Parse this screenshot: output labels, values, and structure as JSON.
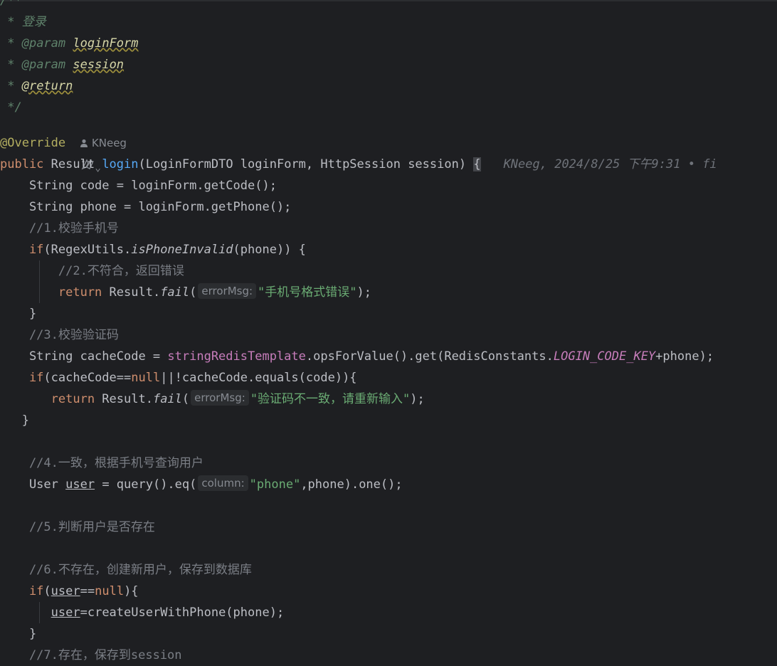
{
  "colors": {
    "background": "#1e1f22",
    "keyword": "#cf8e6d",
    "string": "#6aab73",
    "function": "#56a8f5",
    "comment": "#7a7e85",
    "doc": "#5f826b",
    "field": "#c77dbb",
    "annotation": "#b3ae60"
  },
  "doc": {
    "open": "/**",
    "title": " * 登录",
    "param_prefix": " * ",
    "param_tag": "@param",
    "param1": "loginForm",
    "param2": "session",
    "return_tag": "@return",
    "close": " */"
  },
  "gutter": {
    "ai_icon": "ai-assistant-icon",
    "chevron": "⌄",
    "person_icon": "person-icon",
    "author": "KNeeg"
  },
  "code": {
    "override": "@Override",
    "sig_public": "public",
    "sig_type": " Result ",
    "sig_name": "login",
    "sig_params": "(LoginFormDTO loginForm, HttpSession session) ",
    "sig_brace": "{",
    "blame": "KNeeg, 2024/8/25 下午9:31 • fi",
    "l1": "    String code = loginForm.getCode();",
    "l2": "    String phone = loginForm.getPhone();",
    "c1": "    //1.校验手机号",
    "if1_kw": "    if",
    "if1_a": "(RegexUtils.",
    "if1_fn": "isPhoneInvalid",
    "if1_b": "(phone)) {",
    "c2": "        //2.不符合，返回错误",
    "ret1_kw": "        return",
    "ret1_a": " Result.",
    "ret1_fn": "fail",
    "ret1_paren": "(",
    "hint_errorMsg": "errorMsg:",
    "ret1_str": "\"手机号格式错误\"",
    "ret1_end": ");",
    "close1": "    }",
    "c3": "    //3.校验验证码",
    "cache_a": "    String cacheCode = ",
    "cache_field": "stringRedisTemplate",
    "cache_b": ".opsForValue().get(RedisConstants.",
    "cache_const": "LOGIN_CODE_KEY",
    "cache_c": "+phone);",
    "if2_kw": "    if",
    "if2_a": "(cacheCode==",
    "if2_null": "null",
    "if2_b": "||!cacheCode.equals(code)){",
    "ret2_kw": "       return",
    "ret2_a": " Result.",
    "ret2_fn": "fail",
    "ret2_paren": "(",
    "ret2_str": "\"验证码不一致，请重新输入\"",
    "ret2_end": ");",
    "close2": "   }",
    "c4": "    //4.一致，根据手机号查询用户",
    "user_a": "    User ",
    "user_var": "user",
    "user_b": " = query().eq(",
    "hint_column": "column:",
    "user_str": "\"phone\"",
    "user_c": ",phone).one();",
    "c5": "    //5.判断用户是否存在",
    "c6": "    //6.不存在，创建新用户，保存到数据库",
    "if3_kw": "    if",
    "if3_a": "(",
    "if3_var": "user",
    "if3_b": "==",
    "if3_null": "null",
    "if3_c": "){",
    "assign_pre": "       ",
    "assign_var": "user",
    "assign_b": "=createUserWithPhone(phone);",
    "close3": "    }",
    "c7": "    //7.存在，保存到session"
  }
}
